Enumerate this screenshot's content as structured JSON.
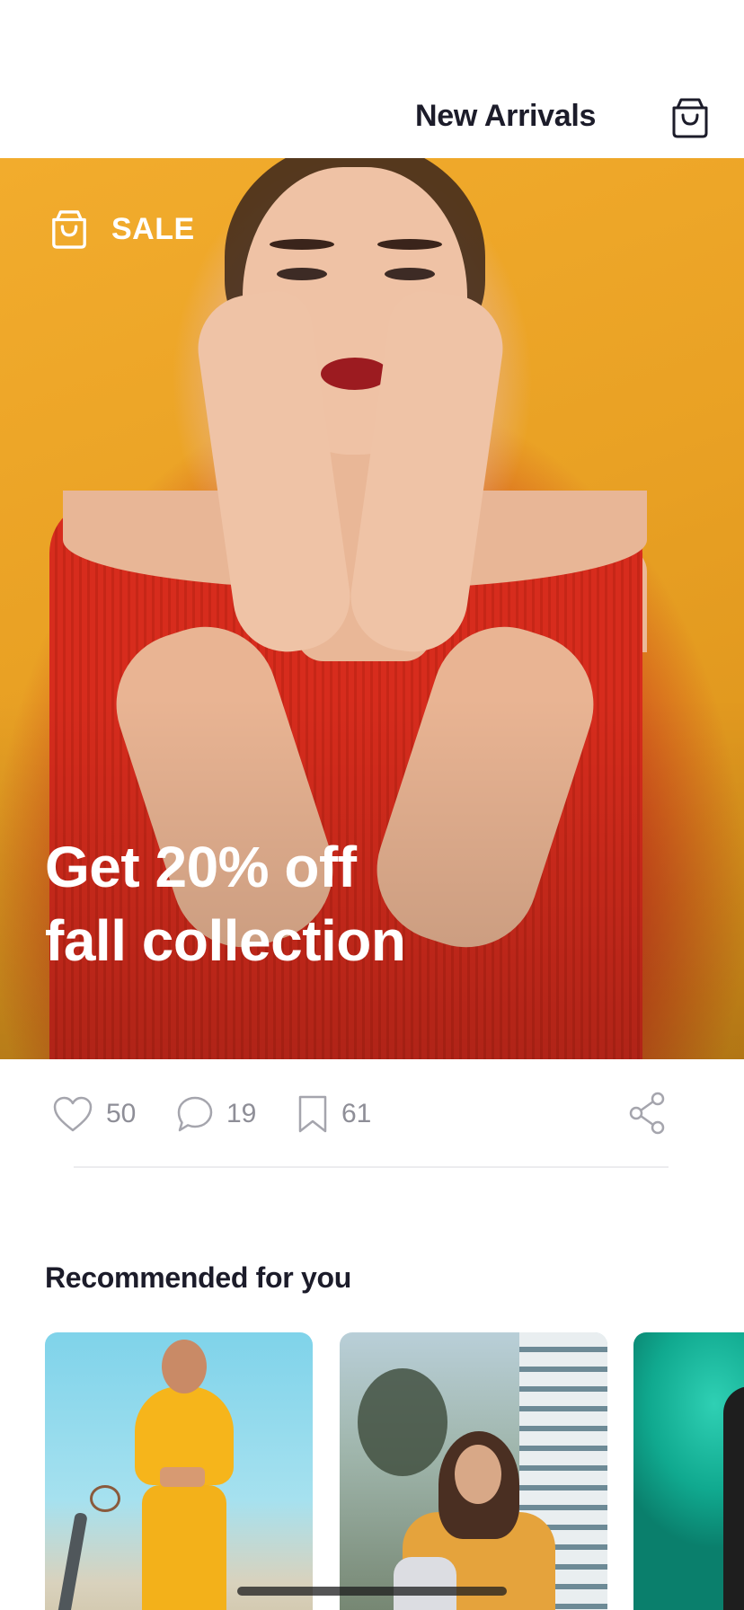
{
  "header": {
    "title": "New Arrivals",
    "cart_icon": "shopping-bag-icon"
  },
  "hero": {
    "badge_icon": "shopping-bag-icon",
    "badge_label": "SALE",
    "headline_line1": "Get 20% off",
    "headline_line2": "fall collection"
  },
  "actions": {
    "likes": {
      "icon": "heart-icon",
      "count": "50"
    },
    "comments": {
      "icon": "comment-icon",
      "count": "19"
    },
    "saves": {
      "icon": "bookmark-icon",
      "count": "61"
    },
    "share_icon": "share-icon"
  },
  "recommended": {
    "title": "Recommended for you",
    "items": [
      {
        "name": "recommended-item-1"
      },
      {
        "name": "recommended-item-2"
      },
      {
        "name": "recommended-item-3"
      }
    ]
  },
  "colors": {
    "text_primary": "#1c1c2a",
    "text_muted": "#8e8e97",
    "hero_background": "#eda426",
    "hero_top": "#d72c1d"
  }
}
